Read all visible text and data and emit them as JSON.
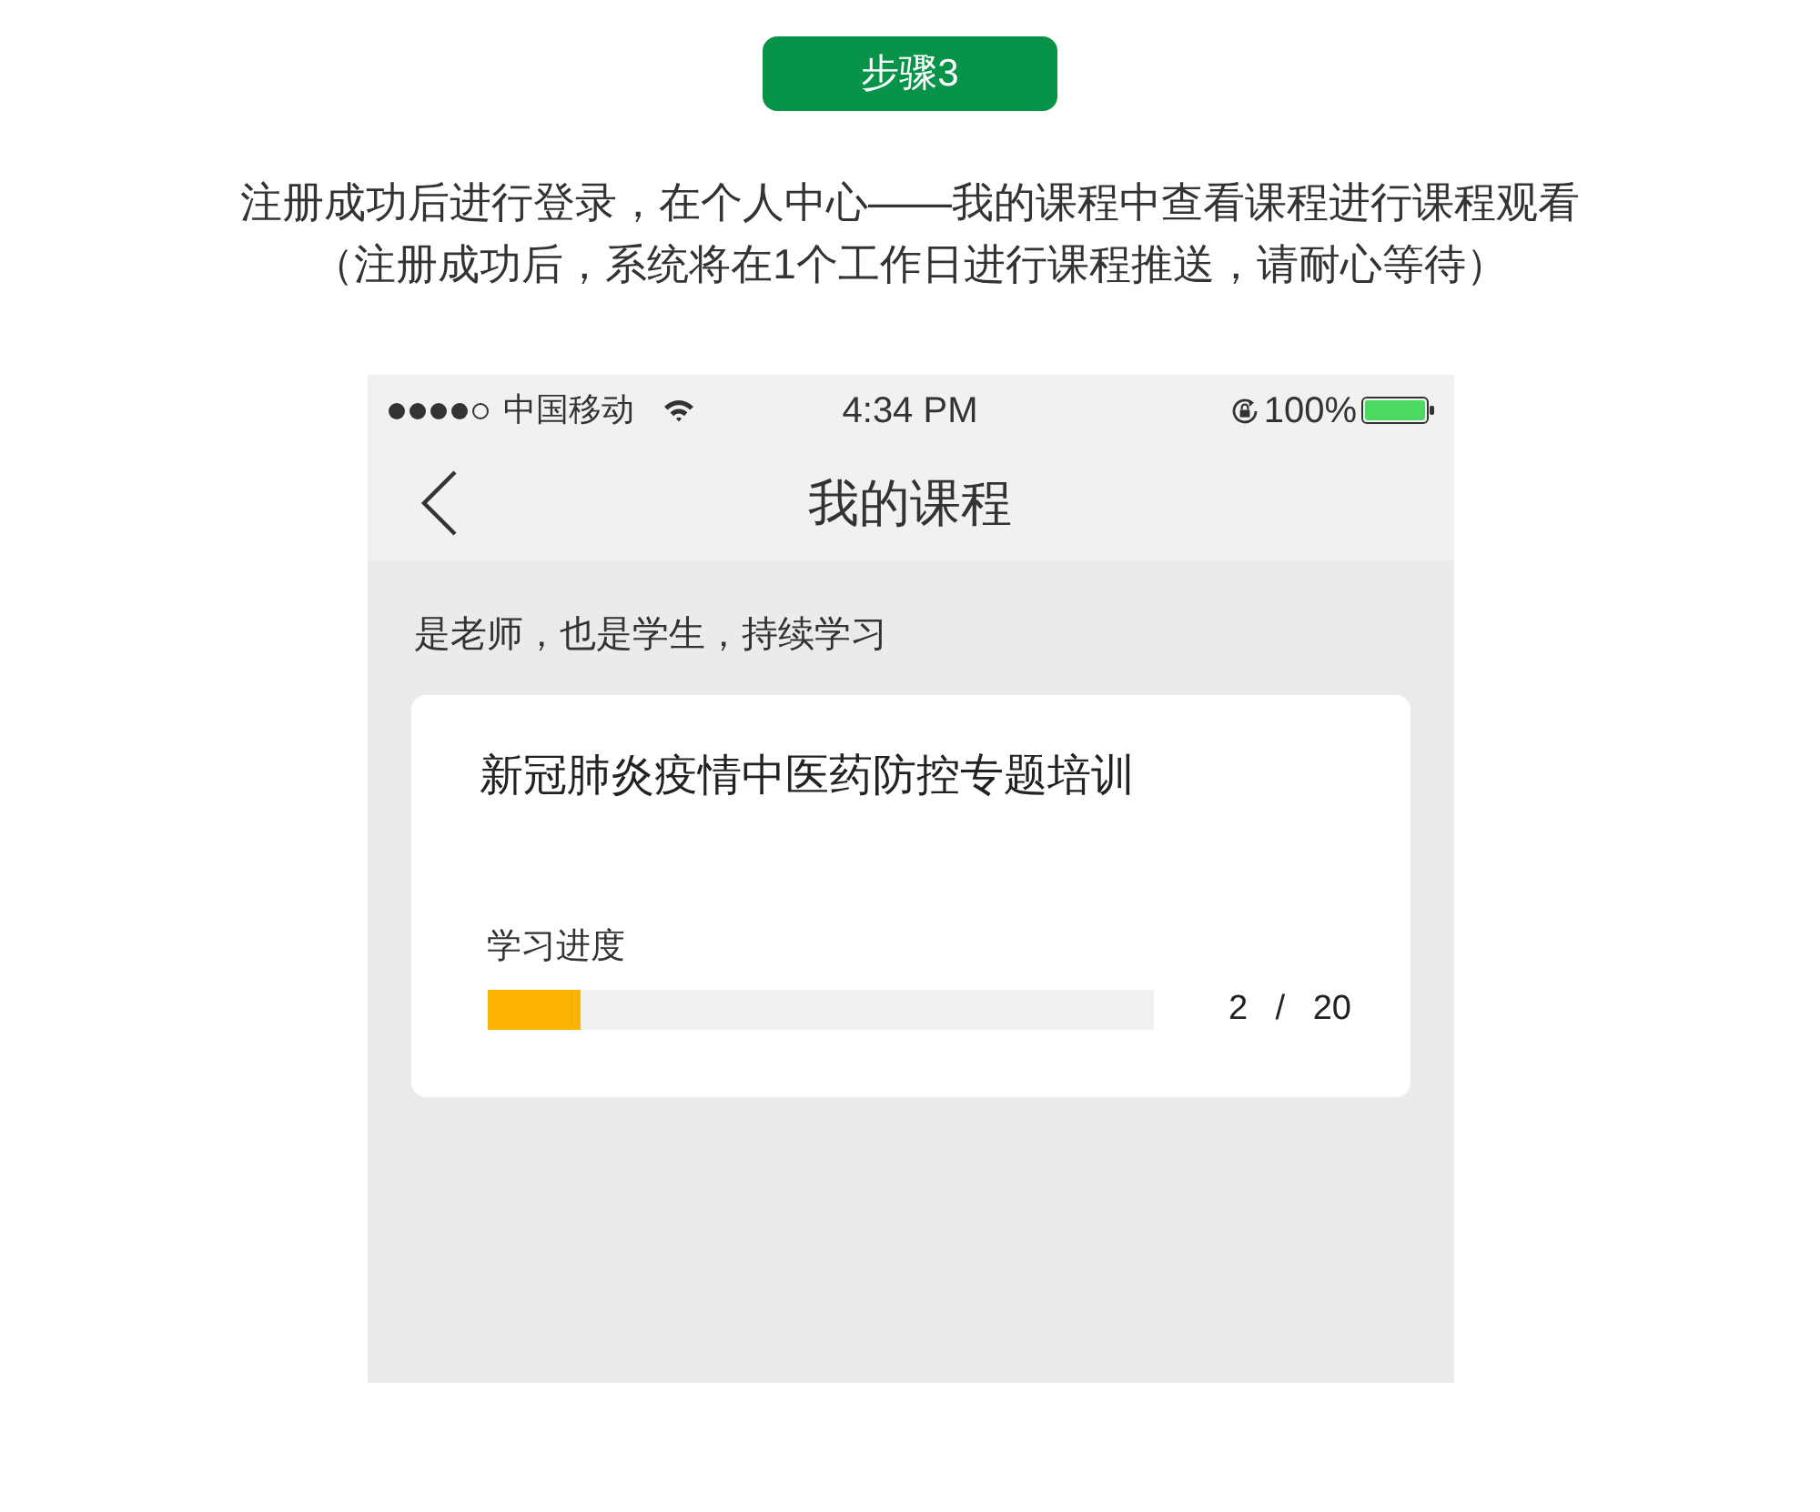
{
  "step_badge": {
    "label": "步骤3"
  },
  "instructions": [
    "注册成功后进行登录，在个人中心——我的课程中查看课程进行课程观看",
    "（注册成功后，系统将在1个工作日进行课程推送，请耐心等待）"
  ],
  "phone": {
    "status_bar": {
      "carrier": "中国移动",
      "time": "4:34 PM",
      "battery": "100%"
    },
    "nav_bar": {
      "title": "我的课程"
    },
    "tagline": "是老师，也是学生，持续学习",
    "courses": [
      {
        "title": "新冠肺炎疫情中医药防控专题培训",
        "progress_label": "学习进度",
        "level": 0.14,
        "count": "2 / 20"
      }
    ]
  }
}
